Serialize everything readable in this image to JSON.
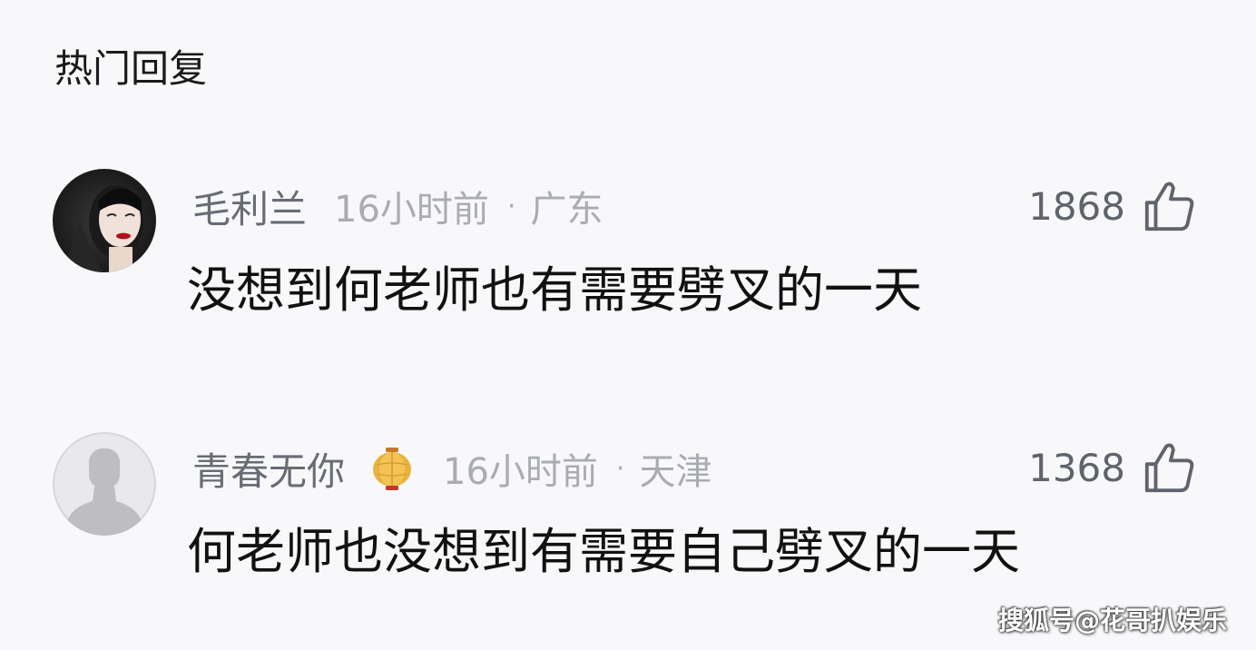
{
  "section": {
    "title": "热门回复"
  },
  "comments": [
    {
      "username": "毛利兰",
      "time": "16小时前",
      "separator": "·",
      "location": "广东",
      "likes": "1868",
      "text": "没想到何老师也有需要劈叉的一天",
      "avatar_icon": "portrait-photo-avatar"
    },
    {
      "username": "青春无你",
      "badge_icon": "lantern-icon",
      "time": "16小时前",
      "separator": "·",
      "location": "天津",
      "likes": "1368",
      "text": "何老师也没想到有需要自己劈叉的一天",
      "avatar_icon": "default-user-avatar"
    }
  ],
  "watermark": "搜狐号@花哥扒娱乐",
  "colors": {
    "background": "#f8f8fa",
    "username": "#686c75",
    "meta": "#a9acb2",
    "text": "#111111"
  }
}
